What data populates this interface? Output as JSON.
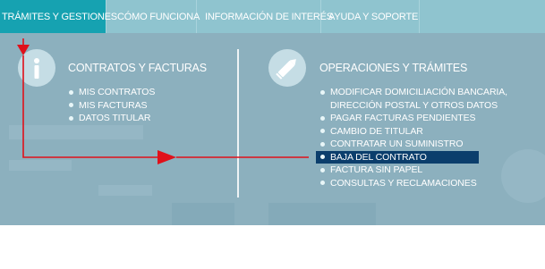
{
  "nav": {
    "tabs": [
      "TRÁMITES Y GESTIONES",
      "CÓMO FUNCIONA",
      "INFORMACIÓN DE INTERÉS",
      "AYUDA Y SOPORTE"
    ],
    "active_tab": "TRÁMITES Y GESTIONES"
  },
  "left": {
    "icon": "info-icon",
    "title": "CONTRATOS Y FACTURAS",
    "items": [
      "MIS CONTRATOS",
      "MIS FACTURAS",
      "DATOS TITULAR"
    ]
  },
  "right": {
    "icon": "pencil-icon",
    "title": "OPERACIONES Y TRÁMITES",
    "items": [
      "MODIFICAR DOMICILIACIÓN BANCARIA, DIRECCIÓN POSTAL Y OTROS DATOS",
      "PAGAR FACTURAS PENDIENTES",
      "CAMBIO DE TITULAR",
      "CONTRATAR UN SUMINISTRO",
      "BAJA DEL CONTRATO",
      "FACTURA SIN PAPEL",
      "CONSULTAS Y RECLAMACIONES"
    ],
    "highlighted_item": "BAJA DEL CONTRATO"
  },
  "colors": {
    "nav_background": "#8fc4cf",
    "active_tab": "#16a2b1",
    "panel_background": "#8cb0be",
    "highlight": "#0b3e6c",
    "arrow": "#e0101a",
    "text": "#ffffff"
  }
}
